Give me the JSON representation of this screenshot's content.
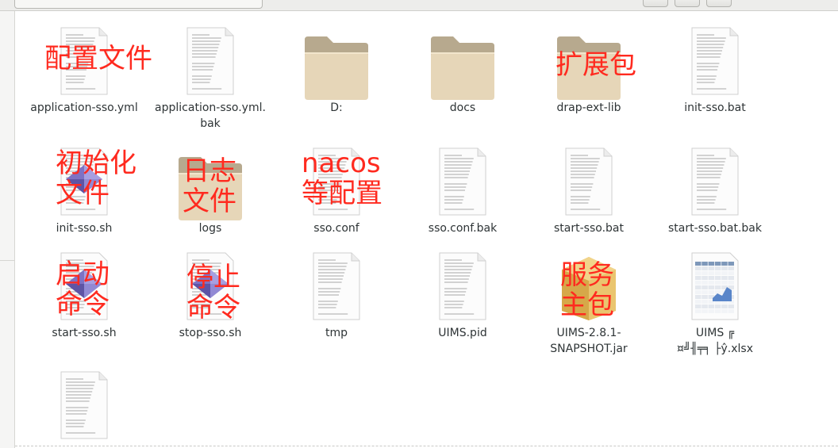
{
  "files": [
    {
      "id": "application-sso-yml",
      "label": "application-sso.yml",
      "icon": "text-file-icon",
      "annotation": "配置文件"
    },
    {
      "id": "application-sso-yml-bak",
      "label": "application-sso.yml.",
      "label2": "bak",
      "icon": "text-file-icon"
    },
    {
      "id": "D",
      "label": "D:",
      "icon": "folder-icon"
    },
    {
      "id": "docs",
      "label": "docs",
      "icon": "folder-icon"
    },
    {
      "id": "drap-ext-lib",
      "label": "drap-ext-lib",
      "icon": "folder-icon",
      "annotation": "扩展包"
    },
    {
      "id": "init-sso-bat",
      "label": "init-sso.bat",
      "icon": "text-file-icon"
    },
    {
      "id": "init-sso-sh",
      "label": "init-sso.sh",
      "icon": "script-icon",
      "annotation": "初始化",
      "annotation2": "文件"
    },
    {
      "id": "logs",
      "label": "logs",
      "icon": "folder-icon",
      "annotation": "日志",
      "annotation2": "文件"
    },
    {
      "id": "sso-conf",
      "label": "sso.conf",
      "icon": "text-file-icon",
      "annotation": "nacos",
      "annotation2": "等配置"
    },
    {
      "id": "sso-conf-bak",
      "label": "sso.conf.bak",
      "icon": "text-file-icon"
    },
    {
      "id": "start-sso-bat",
      "label": "start-sso.bat",
      "icon": "text-file-icon"
    },
    {
      "id": "start-sso-bat-bak",
      "label": "start-sso.bat.bak",
      "icon": "text-file-icon"
    },
    {
      "id": "start-sso-sh",
      "label": "start-sso.sh",
      "icon": "script-icon",
      "annotation": "启动",
      "annotation2": "命令"
    },
    {
      "id": "stop-sso-sh",
      "label": "stop-sso.sh",
      "icon": "script-icon",
      "annotation": "停止",
      "annotation2": "命令"
    },
    {
      "id": "tmp",
      "label": "tmp",
      "icon": "text-file-icon"
    },
    {
      "id": "UIMS-pid",
      "label": "UIMS.pid",
      "icon": "text-file-icon"
    },
    {
      "id": "UIMS-jar",
      "label": "UIMS-2.8.1-",
      "label2": "SNAPSHOT.jar",
      "icon": "package-icon",
      "annotation": "服务",
      "annotation2": "主包"
    },
    {
      "id": "UIMS-xlsx",
      "label": "UIMS ╔",
      "label2": "¤╝╢╤╕ ├ŷ.xlsx",
      "icon": "spreadsheet-icon"
    },
    {
      "id": "unnamed-text",
      "label": "",
      "icon": "text-file-icon"
    }
  ]
}
